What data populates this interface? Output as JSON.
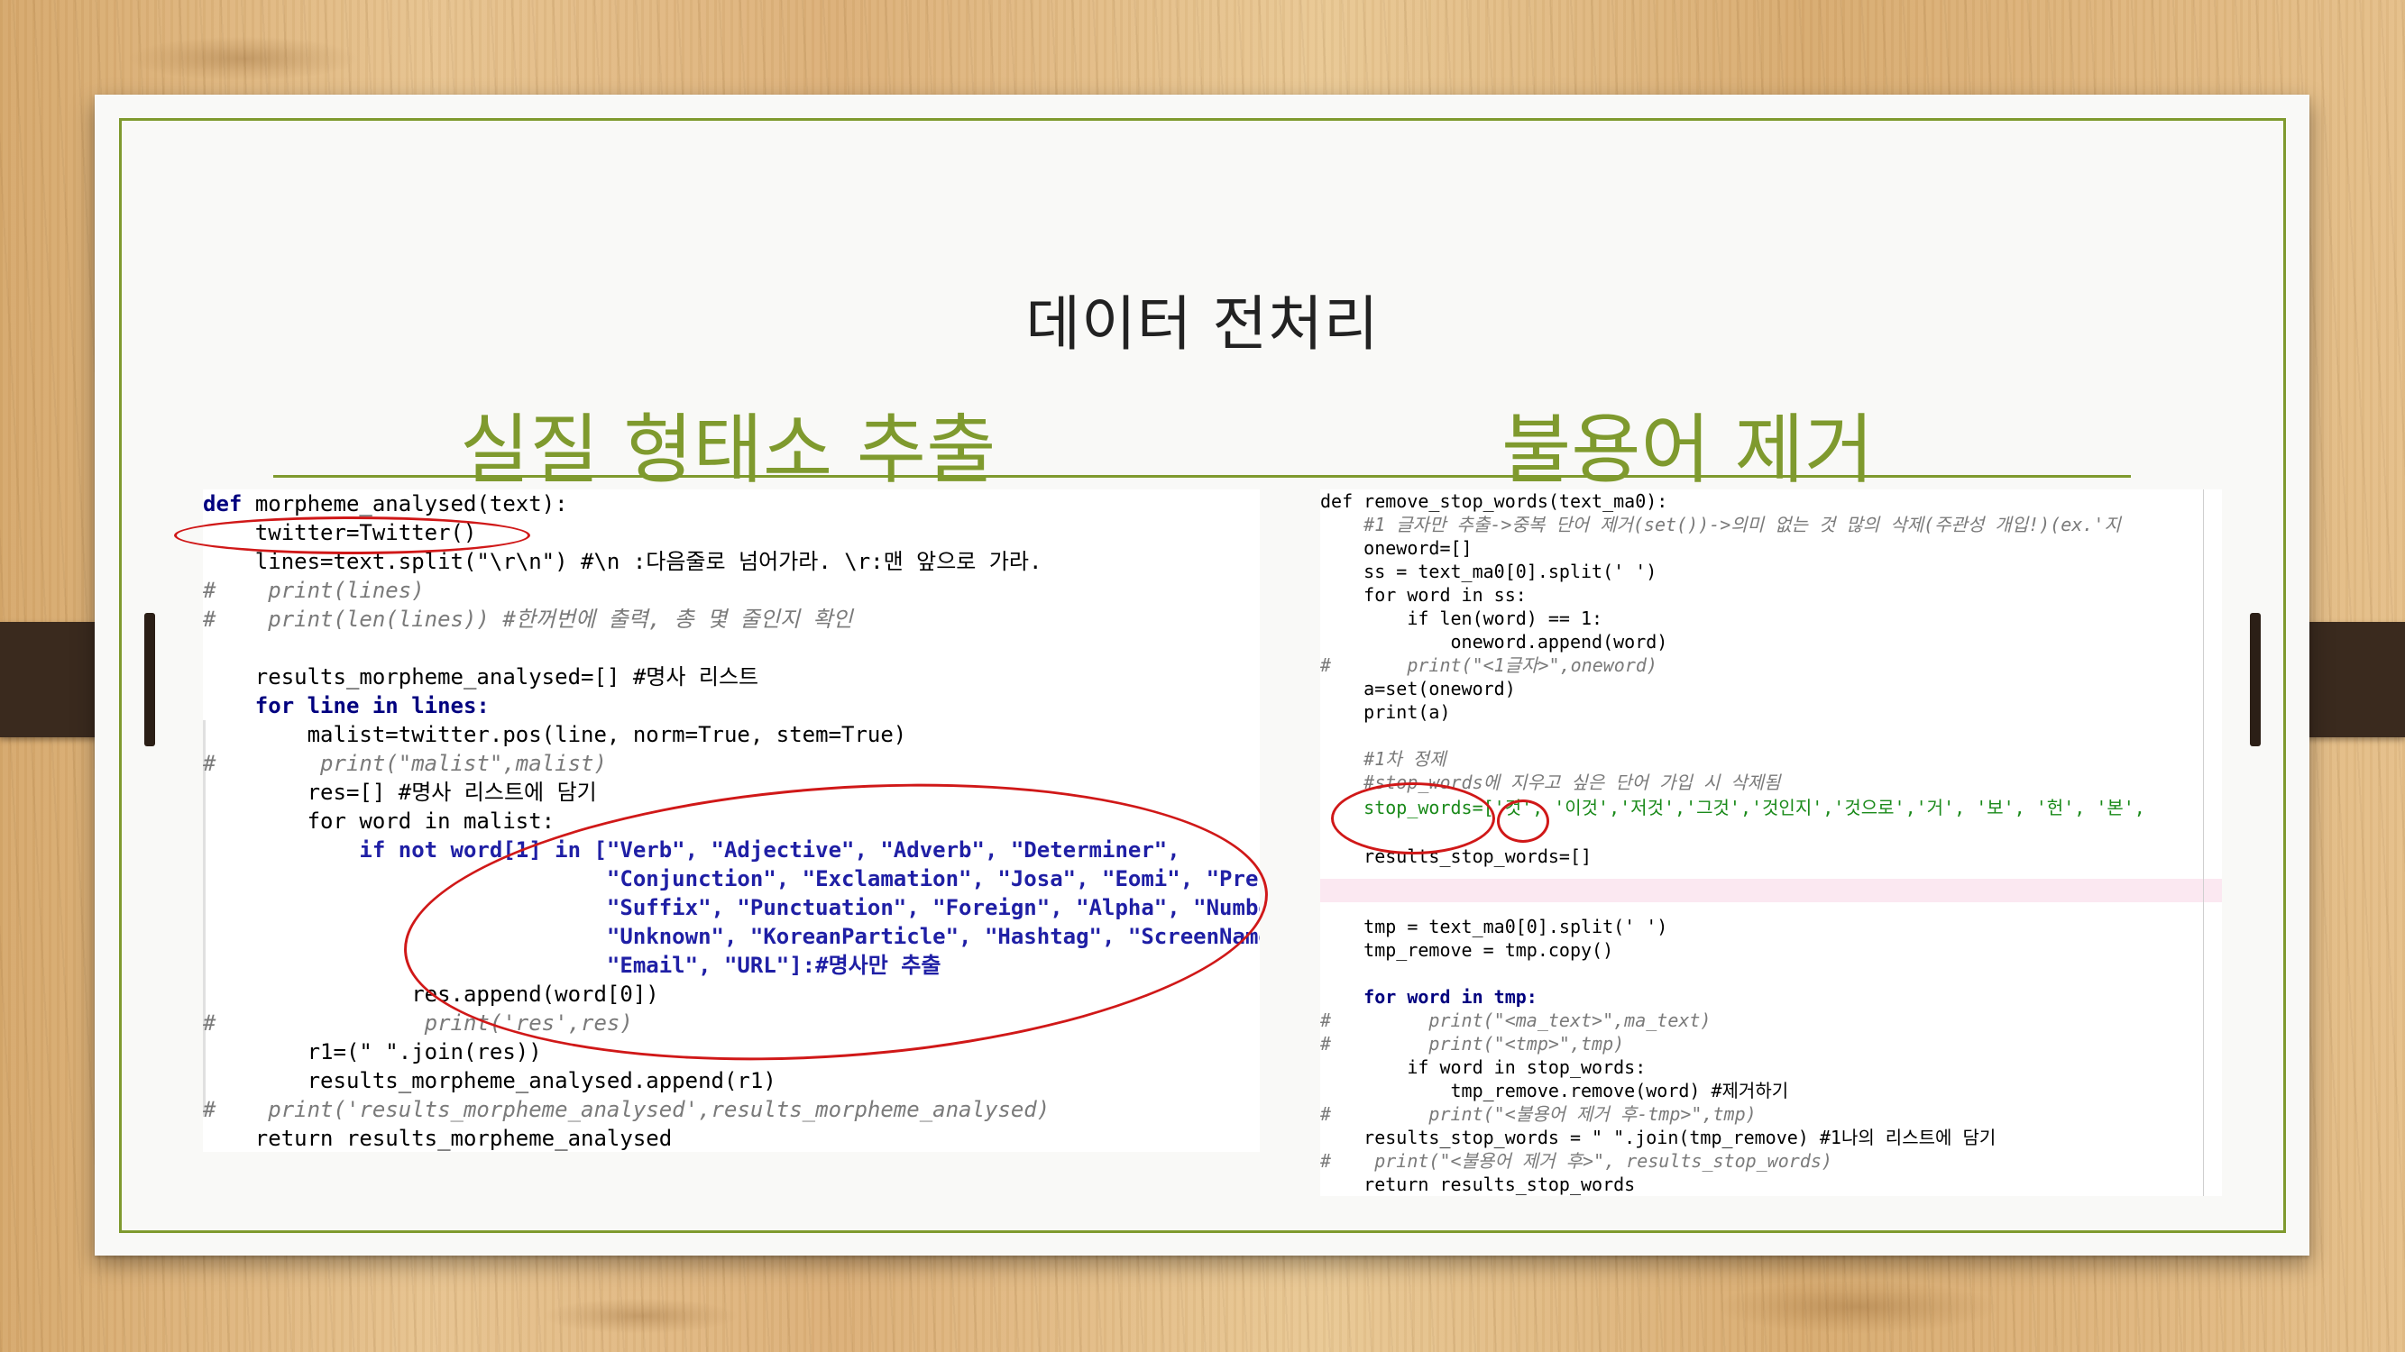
{
  "slide": {
    "title": "데이터 전처리",
    "left_heading": "실질 형태소 추출",
    "right_heading": "불용어 제거"
  },
  "colors": {
    "accent": "#7f9a2e",
    "annotation": "#d01818",
    "strap": "#3a2a1e"
  },
  "left_code": [
    "def morpheme_analysed(text):",
    "    twitter=Twitter()",
    "    lines=text.split(\"\\r\\n\") #\\n :다음줄로 넘어가라. \\r:맨 앞으로 가라.",
    "#    print(lines)",
    "#    print(len(lines)) #한꺼번에 출력, 총 몇 줄인지 확인",
    "",
    "    results_morpheme_analysed=[] #명사 리스트",
    "    for line in lines:",
    "        malist=twitter.pos(line, norm=True, stem=True)",
    "#        print(\"malist\",malist)",
    "        res=[] #명사 리스트에 담기",
    "        for word in malist:",
    "            if not word[1] in [\"Verb\", \"Adjective\", \"Adverb\", \"Determiner\",",
    "                               \"Conjunction\", \"Exclamation\", \"Josa\", \"Eomi\", \"PreEomi\",",
    "                               \"Suffix\", \"Punctuation\", \"Foreign\", \"Alpha\", \"Number\",",
    "                               \"Unknown\", \"KoreanParticle\", \"Hashtag\", \"ScreenName\",",
    "                               \"Email\", \"URL\"]:#명사만 추출",
    "                res.append(word[0])",
    "#                print('res',res)",
    "        r1=(\" \".join(res))",
    "        results_morpheme_analysed.append(r1)",
    "#    print('results_morpheme_analysed',results_morpheme_analysed)",
    "    return results_morpheme_analysed"
  ],
  "right_code": [
    "def remove_stop_words(text_ma0):",
    "    #1 글자만 추출->중복 단어 제거(set())->의미 없는 것 많의 삭제(주관성 개입!)(ex.'지",
    "    oneword=[]",
    "    ss = text_ma0[0].split(' ')",
    "    for word in ss:",
    "        if len(word) == 1:",
    "            oneword.append(word)",
    "#       print(\"<1글자>\",oneword)",
    "    a=set(oneword)",
    "    print(a)",
    "",
    "    #1차 정제",
    "    #stop_words에 지우고 싶은 단어 가입 시 삭제됨",
    "    stop_words=['것', '이것','저것','그것','것인지','것으로','거', '보', '헌', '본',",
    "",
    "    results_stop_words=[]",
    "",
    "    tmp = text_ma0[0].split(' ')",
    "    tmp_remove = tmp.copy()",
    "",
    "    for word in tmp:",
    "#         print(\"<ma_text>\",ma_text)",
    "#         print(\"<tmp>\",tmp)",
    "        if word in stop_words:",
    "            tmp_remove.remove(word) #제거하기",
    "#         print(\"<불용어 제거 후-tmp>\",tmp)",
    "    results_stop_words = \" \".join(tmp_remove) #1나의 리스트에 담기",
    "#    print(\"<불용어 제거 후>\", results_stop_words)",
    "    return results_stop_words"
  ]
}
